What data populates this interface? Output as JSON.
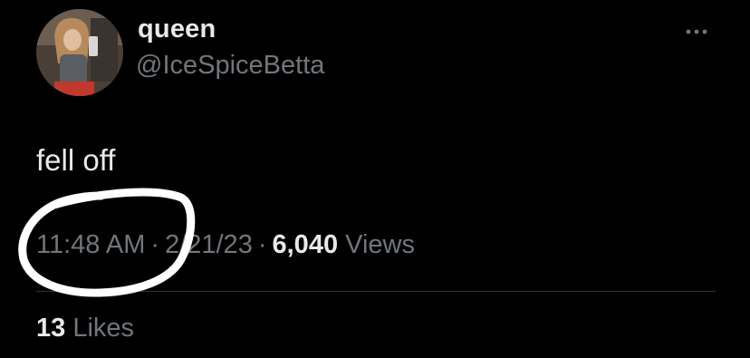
{
  "author": {
    "display_name": "queen",
    "handle": "@IceSpiceBetta"
  },
  "icons": {
    "more": "more-horizontal-icon",
    "avatar": "profile-avatar"
  },
  "tweet": {
    "text": "fell off",
    "time": "11:48 AM",
    "date": "2/21/23",
    "separator": "·",
    "views_count": "6,040",
    "views_label": "Views"
  },
  "stats": {
    "likes_count": "13",
    "likes_label": "Likes"
  },
  "colors": {
    "background": "#000000",
    "primary_text": "#e7e9ea",
    "secondary_text": "#71767b",
    "divider": "#2f3336",
    "annotation": "#ffffff"
  }
}
